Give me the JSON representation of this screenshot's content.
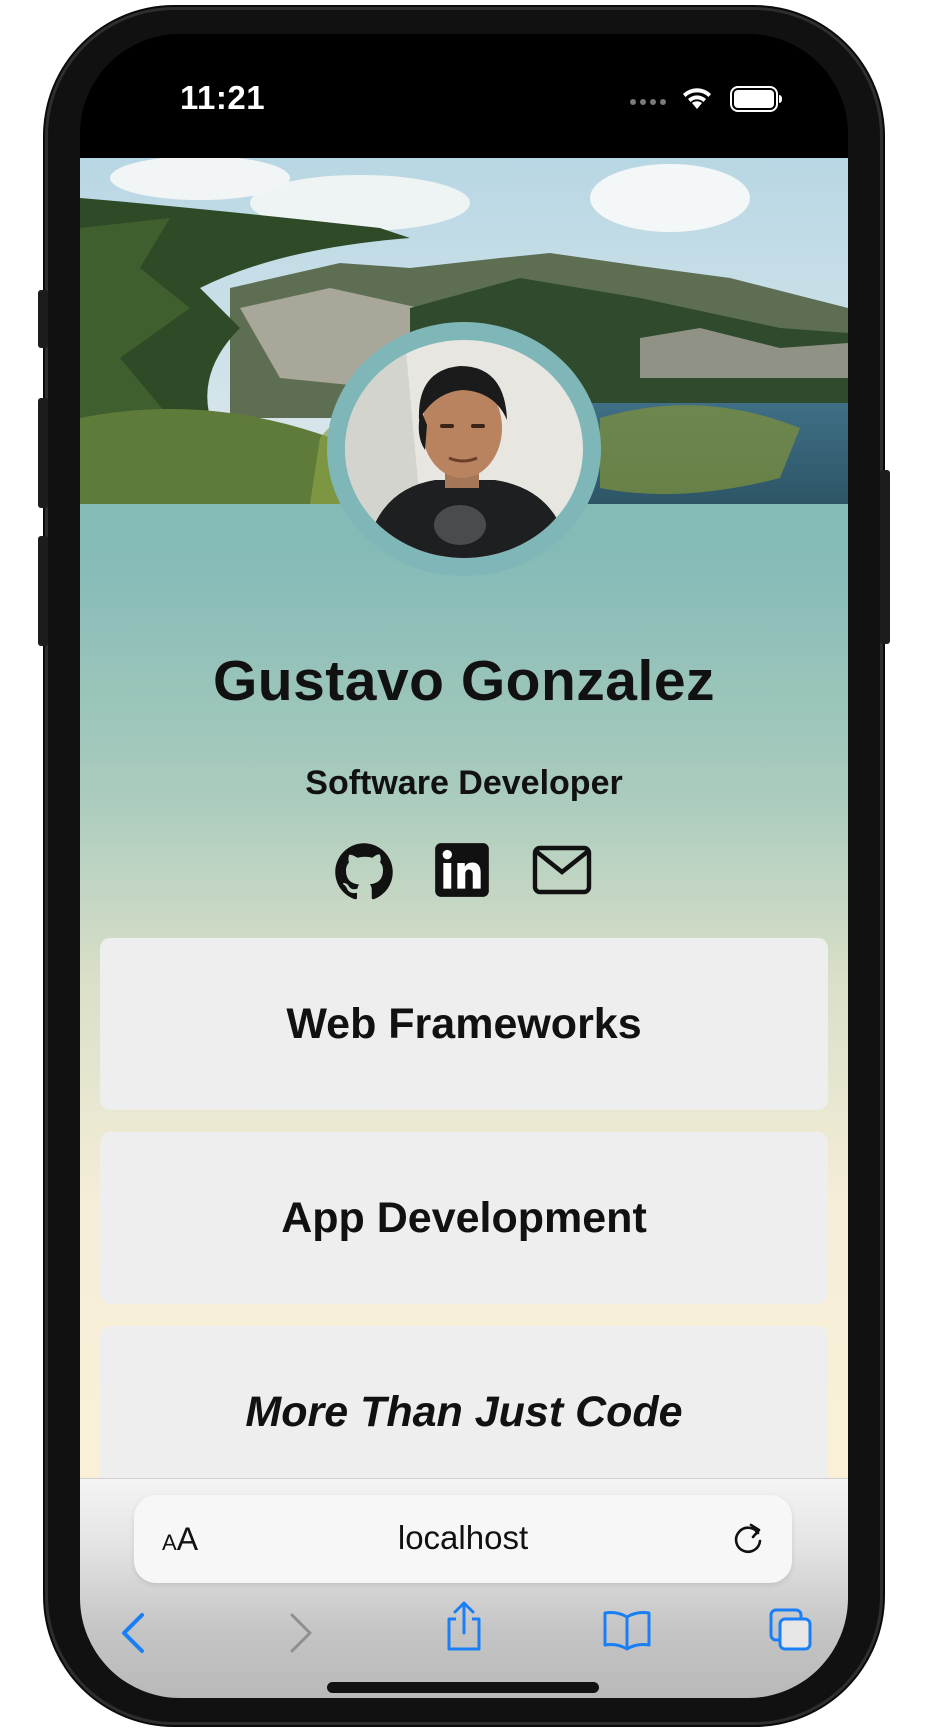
{
  "status_bar": {
    "time": "11:21",
    "icons": [
      "cellular-dots-icon",
      "wifi-icon",
      "battery-icon"
    ]
  },
  "profile": {
    "name": "Gustavo Gonzalez",
    "title": "Software Developer",
    "socials": [
      "github-icon",
      "linkedin-icon",
      "mail-icon"
    ]
  },
  "cards": [
    {
      "label": "Web Frameworks"
    },
    {
      "label": "App Development"
    },
    {
      "label": "More Than Just Code"
    }
  ],
  "browser": {
    "text_size_big": "A",
    "text_size_small": "A",
    "url": "localhost",
    "toolbar_icons": [
      "back-icon",
      "forward-icon",
      "share-icon",
      "bookmarks-icon",
      "tabs-icon"
    ]
  },
  "colors": {
    "accent": "#1a7ff7",
    "gradient_top": "#80b9b8",
    "gradient_bottom": "#f9f0d7",
    "card_bg": "#eeeeee"
  }
}
